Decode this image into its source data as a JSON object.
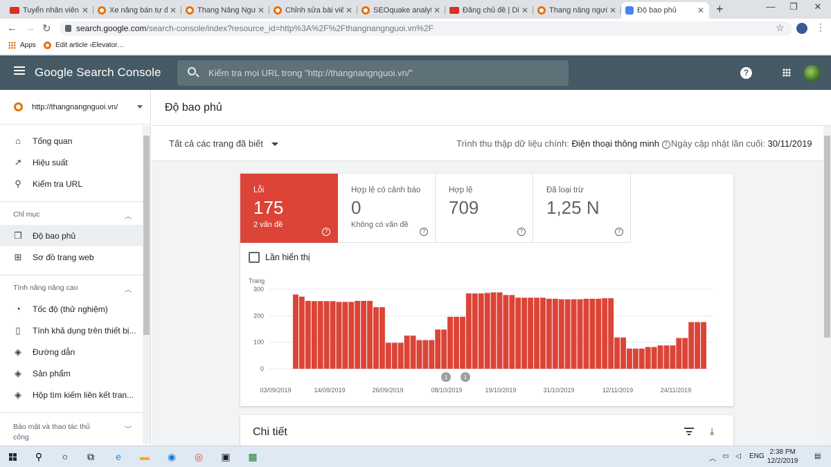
{
  "browser": {
    "tabs": [
      {
        "title": "Tuyển nhân viên v",
        "favicon": "ds-icon"
      },
      {
        "title": "Xe nâng bán tự độ",
        "favicon": "orange-circle-icon"
      },
      {
        "title": "Thang Nâng Người",
        "favicon": "orange-circle-icon"
      },
      {
        "title": "Chỉnh sửa bài viết",
        "favicon": "orange-circle-icon"
      },
      {
        "title": "SEOquake analytic",
        "favicon": "seoquake-icon"
      },
      {
        "title": "Đăng chủ đề | Diễn",
        "favicon": "ds-icon"
      },
      {
        "title": "Thang nâng người",
        "favicon": "orange-circle-icon"
      },
      {
        "title": "Độ bao phủ",
        "favicon": "search-console-icon",
        "active": true
      }
    ],
    "url_host": "search.google.com",
    "url_path": "/search-console/index?resource_id=http%3A%2F%2Fthangnangnguoi.vn%2F",
    "bookmarks": [
      {
        "label": "Apps",
        "icon": "apps-grid-icon"
      },
      {
        "label": "Edit article ‹Elevator…",
        "icon": "orange-circle-icon"
      }
    ]
  },
  "header": {
    "title": "Google Search Console",
    "search_placeholder": "Kiểm tra mọi URL trong \"http://thangnangnguoi.vn/\"",
    "color": "#455a64"
  },
  "sidebar": {
    "property": "http://thangnangnguoi.vn/",
    "items": [
      {
        "label": "Tổng quan",
        "icon": "home-icon"
      },
      {
        "label": "Hiệu suất",
        "icon": "trending-icon"
      },
      {
        "label": "Kiểm tra URL",
        "icon": "search-icon"
      }
    ],
    "section_index": "Chỉ mục",
    "index_items": [
      {
        "label": "Độ bao phủ",
        "icon": "copy-icon",
        "selected": true
      },
      {
        "label": "Sơ đồ trang web",
        "icon": "sitemap-icon"
      }
    ],
    "section_enhancements": "Tính năng nâng cao",
    "enhancement_items": [
      {
        "label": "Tốc độ (thử nghiệm)",
        "icon": "speed-icon"
      },
      {
        "label": "Tính khả dụng trên thiết bị...",
        "icon": "phone-icon"
      },
      {
        "label": "Đường dẫn",
        "icon": "layers-icon"
      },
      {
        "label": "Sản phẩm",
        "icon": "layers-icon"
      },
      {
        "label": "Hộp tìm kiếm liên kết tran...",
        "icon": "layers-icon"
      }
    ],
    "section_security": "Bảo mật và thao tác thủ công"
  },
  "page": {
    "title": "Độ bao phủ",
    "filter": "Tất cả các trang đã biết",
    "crawler_label": "Trình thu thập dữ liệu chính:",
    "crawler_value": "Điện thoại thông minh",
    "updated_label": "Ngày cập nhật lần cuối:",
    "updated_value": "30/11/2019"
  },
  "stats": [
    {
      "label": "Lỗi",
      "value": "175",
      "sub": "2 vấn đề",
      "color": "#db4437"
    },
    {
      "label": "Hợp lệ có cảnh báo",
      "value": "0",
      "sub": "Không có vấn đề"
    },
    {
      "label": "Hợp lệ",
      "value": "709",
      "sub": ""
    },
    {
      "label": "Đã loại trừ",
      "value": "1,25 N",
      "sub": ""
    }
  ],
  "impressions_label": "Lần hiển thị",
  "chart_data": {
    "type": "bar",
    "ylabel": "Trang",
    "ylim": [
      0,
      300
    ],
    "yticks": [
      0,
      100,
      200,
      300
    ],
    "xticks": [
      "03/09/2019",
      "14/09/2019",
      "26/09/2019",
      "08/10/2019",
      "19/10/2019",
      "31/10/2019",
      "12/11/2019",
      "24/11/2019"
    ],
    "color": "#db4437",
    "annotations": [
      "1",
      "1"
    ],
    "values": [
      280,
      272,
      256,
      255,
      255,
      255,
      255,
      252,
      252,
      252,
      256,
      256,
      256,
      232,
      232,
      98,
      98,
      98,
      125,
      125,
      108,
      108,
      108,
      148,
      148,
      196,
      196,
      196,
      284,
      284,
      284,
      286,
      288,
      288,
      278,
      278,
      268,
      268,
      268,
      268,
      268,
      264,
      264,
      262,
      262,
      262,
      262,
      264,
      264,
      264,
      266,
      266,
      118,
      118,
      76,
      76,
      76,
      82,
      82,
      88,
      88,
      88,
      116,
      116,
      176,
      176,
      176
    ]
  },
  "details_title": "Chi tiết",
  "taskbar": {
    "lang": "ENG",
    "time": "2:38 PM",
    "date": "12/2/2019"
  }
}
